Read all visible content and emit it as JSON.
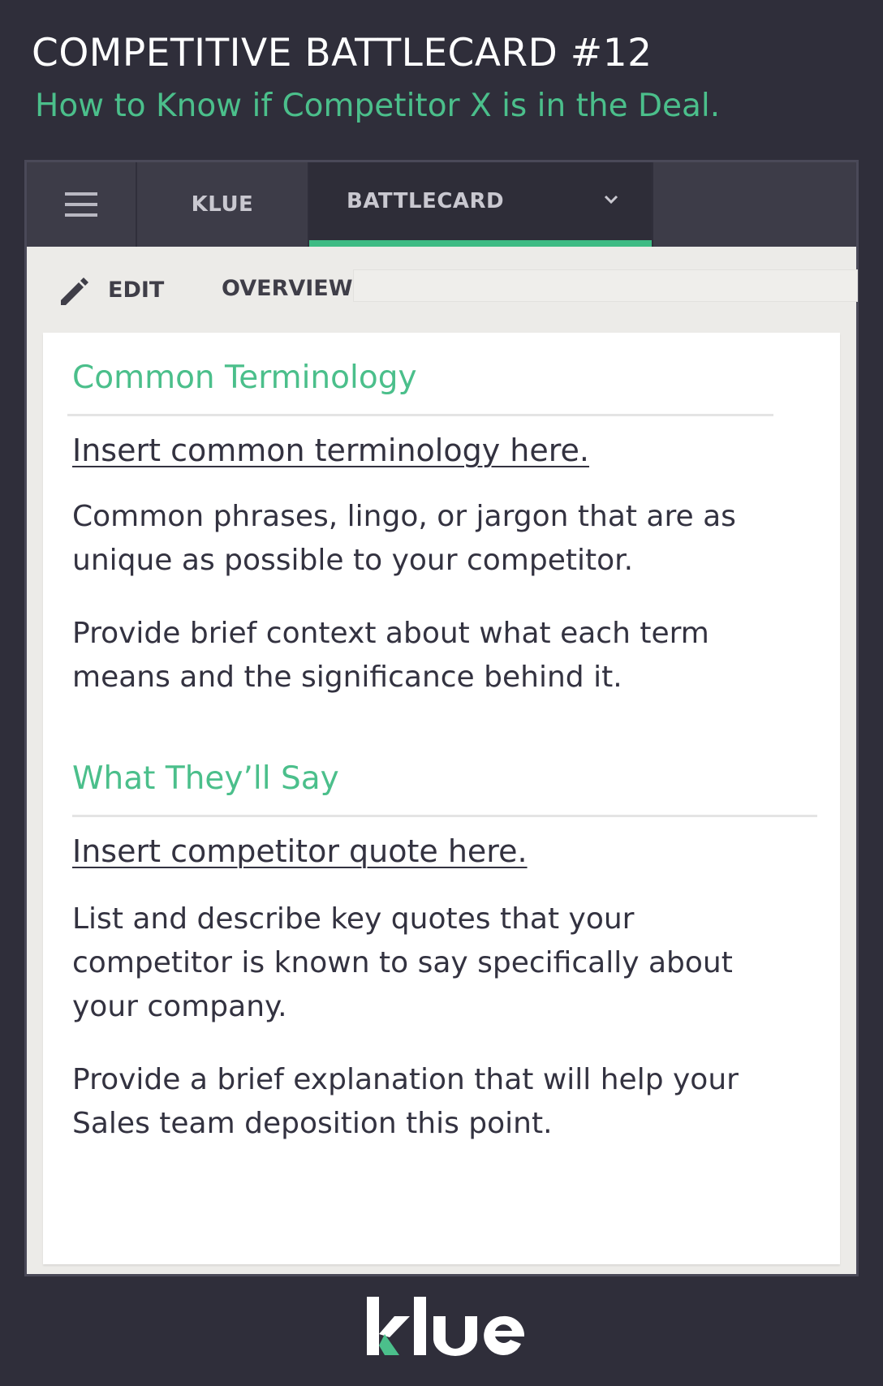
{
  "header": {
    "title": "COMPETITIVE BATTLECARD #12",
    "subtitle": "How to Know if Competitor X is in the Deal."
  },
  "nav": {
    "menu_icon": "hamburger-menu-icon",
    "tabs": [
      {
        "label": "KLUE"
      },
      {
        "label": "BATTLECARD"
      }
    ],
    "dropdown_icon": "chevron-down-icon"
  },
  "toolbar": {
    "edit_icon": "pencil-icon",
    "edit_label": "EDIT",
    "overview_label": "OVERVIEW"
  },
  "card": {
    "sections": [
      {
        "title": "Common Terminology",
        "link": "Insert common terminology here.",
        "paragraphs": [
          "Common phrases, lingo, or jargon that are as unique as possible to your competitor.",
          "Provide brief context about what each term means and the significance behind it."
        ]
      },
      {
        "title": "What They’ll Say",
        "link": "Insert competitor quote here.",
        "paragraphs": [
          "List and describe key quotes that your competitor is known to say specifically about your company.",
          "Provide a brief explanation that will help your Sales team deposition this point."
        ]
      }
    ]
  },
  "footer": {
    "logo_text": "klue"
  },
  "colors": {
    "background": "#2f2e3a",
    "accent": "#4bbf8b",
    "nav": "#3d3c48",
    "text": "#333240"
  }
}
